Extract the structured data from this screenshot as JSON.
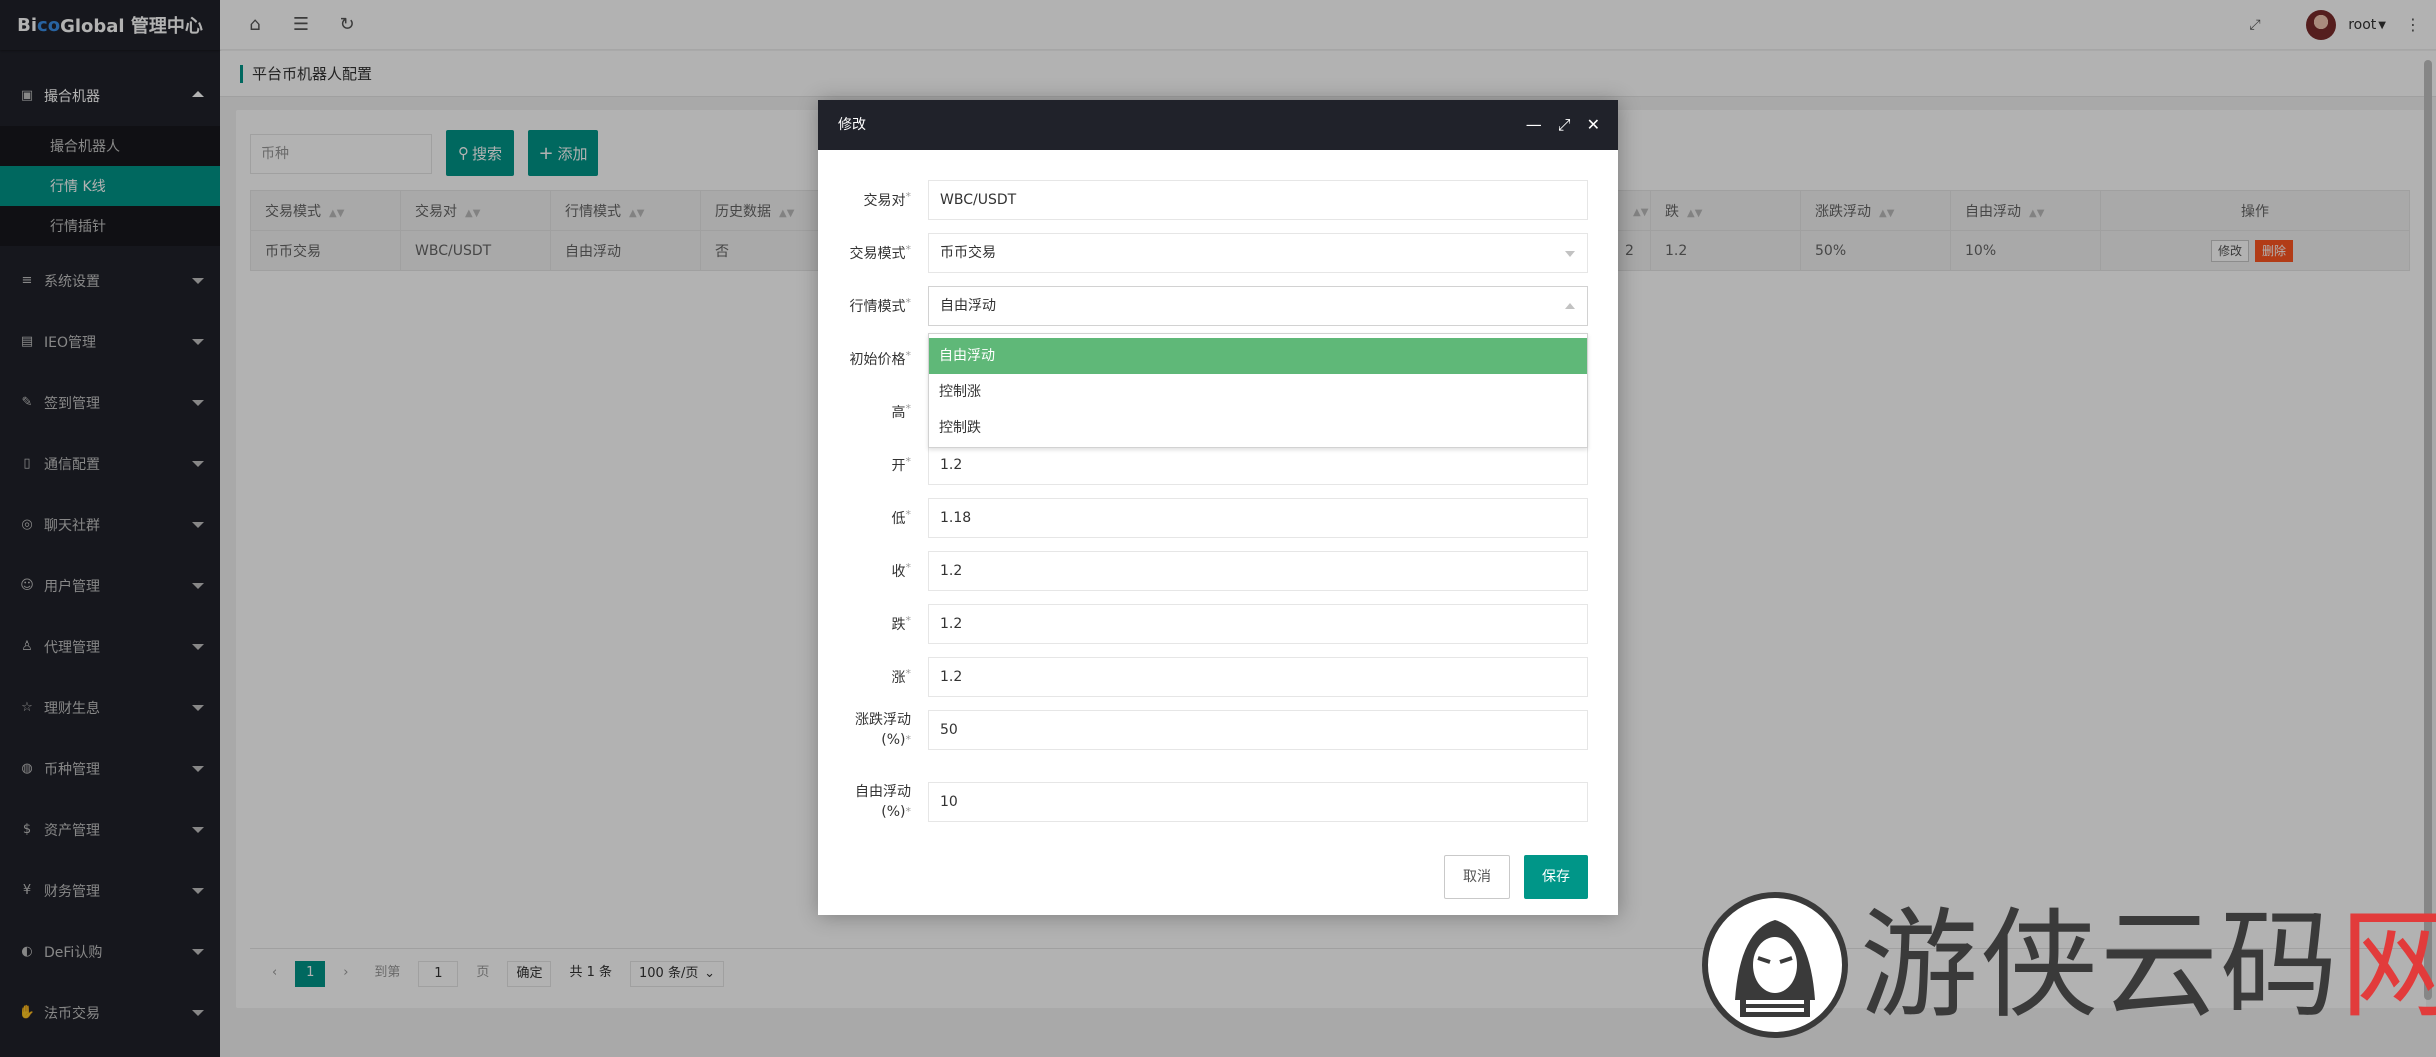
{
  "app": {
    "logo_prefix": "Bi",
    "logo_co": "co",
    "logo_suffix": " Global 管理中心"
  },
  "sidebar": {
    "open_menu": {
      "label": "撮合机器",
      "icon": "robot-icon"
    },
    "sub_items": [
      {
        "label": "撮合机器人",
        "active": false
      },
      {
        "label": "行情 K线",
        "active": true
      },
      {
        "label": "行情插针",
        "active": false
      }
    ],
    "items": [
      {
        "label": "系统设置",
        "icon": "sliders-icon"
      },
      {
        "label": "IEO管理",
        "icon": "document-icon"
      },
      {
        "label": "签到管理",
        "icon": "edit-icon"
      },
      {
        "label": "通信配置",
        "icon": "phone-icon"
      },
      {
        "label": "聊天社群",
        "icon": "chat-icon"
      },
      {
        "label": "用户管理",
        "icon": "user-icon"
      },
      {
        "label": "代理管理",
        "icon": "person-icon"
      },
      {
        "label": "理财生息",
        "icon": "star-icon"
      },
      {
        "label": "币种管理",
        "icon": "coins-icon"
      },
      {
        "label": "资产管理",
        "icon": "dollar-icon"
      },
      {
        "label": "财务管理",
        "icon": "yen-icon"
      },
      {
        "label": "DeFi认购",
        "icon": "flame-icon"
      },
      {
        "label": "法币交易",
        "icon": "hand-icon"
      }
    ]
  },
  "header": {
    "user": "root"
  },
  "tabbar": {
    "title": "平台币机器人配置"
  },
  "toolbar": {
    "search_placeholder": "币种",
    "search_label": "搜索",
    "add_label": "添加"
  },
  "table": {
    "left_headers": [
      "交易模式",
      "交易对",
      "行情模式",
      "历史数据"
    ],
    "right_headers": [
      "跌",
      "涨跌浮动",
      "自由浮动"
    ],
    "action_header": "操作",
    "row": {
      "left": [
        "币币交易",
        "WBC/USDT",
        "自由浮动",
        "否"
      ],
      "partial": "2",
      "right": [
        "1.2",
        "50%",
        "10%"
      ],
      "edit": "修改",
      "delete": "删除"
    }
  },
  "pager": {
    "current": "1",
    "goto": "到第",
    "page_input": "1",
    "page_unit": "页",
    "confirm": "确定",
    "total": "共 1 条",
    "per_page": "100 条/页"
  },
  "modal": {
    "title": "修改",
    "fields": {
      "pair": {
        "label": "交易对",
        "value": "WBC/USDT"
      },
      "trade_mode": {
        "label": "交易模式",
        "value": "币币交易"
      },
      "market_mode": {
        "label": "行情模式",
        "value": "自由浮动"
      },
      "init_price": {
        "label": "初始价格"
      },
      "high": {
        "label": "高"
      },
      "open": {
        "label": "开",
        "value": "1.2"
      },
      "low": {
        "label": "低",
        "value": "1.18"
      },
      "close": {
        "label": "收",
        "value": "1.2"
      },
      "fall": {
        "label": "跌",
        "value": "1.2"
      },
      "rise": {
        "label": "涨",
        "value": "1.2"
      },
      "range_float": {
        "label_1": "涨跌浮动",
        "label_2": "(%)",
        "value": "50"
      },
      "free_float": {
        "label_1": "自由浮动",
        "label_2": "(%)",
        "value": "10"
      }
    },
    "dropdown_options": [
      "自由浮动",
      "控制涨",
      "控制跌"
    ],
    "cancel": "取消",
    "save": "保存"
  },
  "watermark": {
    "text": "游侠云码",
    "x_char": "网"
  },
  "colors": {
    "primary": "#009688",
    "danger": "#ff5722",
    "selected": "#5fb878",
    "sidebar": "#20222a"
  }
}
